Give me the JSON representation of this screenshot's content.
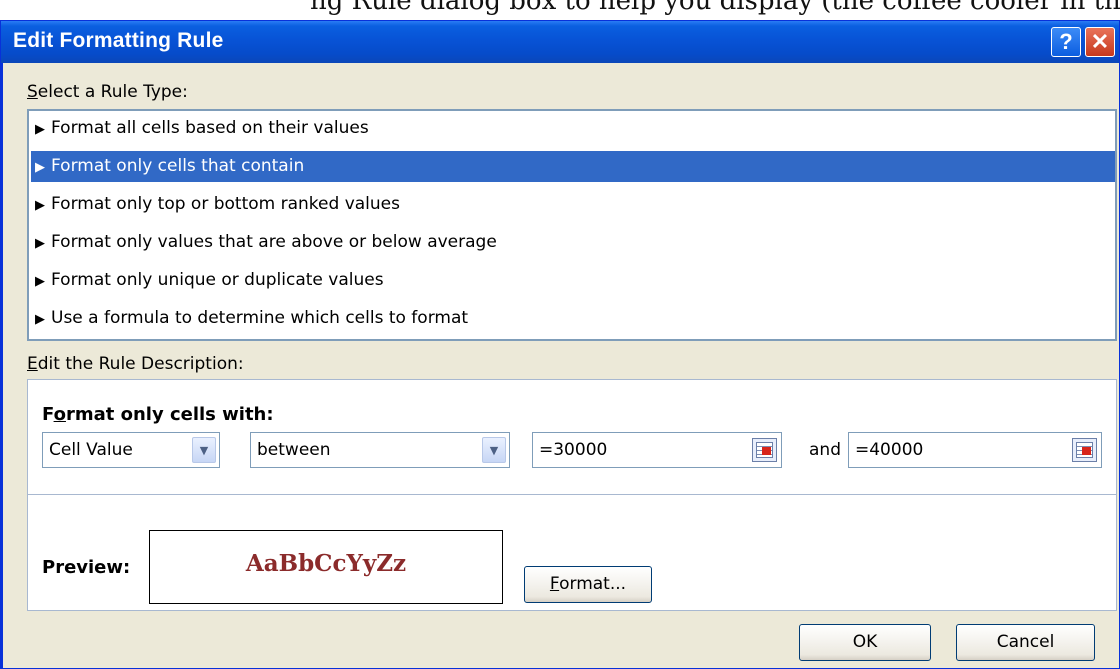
{
  "top_strip": {
    "partial_text": "ng Rule dialog box to help you display (the coffee cooler in this"
  },
  "dialog": {
    "title": "Edit Formatting Rule",
    "help_glyph": "?",
    "close_glyph": "✕",
    "select_label_u": "S",
    "select_label_rest": "elect a Rule Type:",
    "rule_types": [
      {
        "label": "Format all cells based on their values",
        "selected": false
      },
      {
        "label": "Format only cells that contain",
        "selected": true
      },
      {
        "label": "Format only top or bottom ranked values",
        "selected": false
      },
      {
        "label": "Format only values that are above or below average",
        "selected": false
      },
      {
        "label": "Format only unique or duplicate values",
        "selected": false
      },
      {
        "label": "Use a formula to determine which cells to format",
        "selected": false
      }
    ],
    "desc_label_u": "E",
    "desc_label_rest": "dit the Rule Description:",
    "desc_heading_pre": "F",
    "desc_heading_u": "o",
    "desc_heading_rest": "rmat only cells with:",
    "cell_value_select": "Cell Value",
    "operator_select": "between",
    "first_value": "=30000",
    "and_label": "and",
    "second_value": "=40000",
    "preview_label": "Preview:",
    "preview_sample": "AaBbCcYyZz",
    "format_button_u": "F",
    "format_button_rest": "ormat...",
    "ok_label": "OK",
    "cancel_label": "Cancel"
  },
  "colors": {
    "titlebar": "#0853d6",
    "selection": "#3169c6",
    "dialog_bg": "#ece9d8",
    "preview_text": "#8b2b2b"
  },
  "icons": {
    "list_bullet": "triangle-right-icon",
    "dropdown_arrow": "chevron-down-icon",
    "range_picker": "range-select-icon"
  }
}
